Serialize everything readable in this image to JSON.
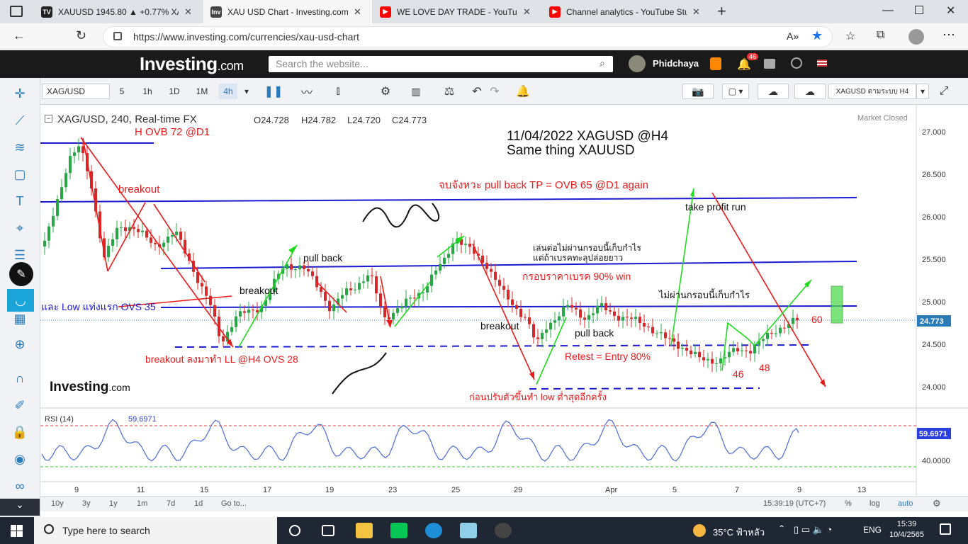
{
  "browser": {
    "tabs": [
      {
        "title": "XAUUSD 1945.80 ▲ +0.77% XAU",
        "icon": "tradingview-icon",
        "color": "#222222"
      },
      {
        "title": "XAU USD Chart - Investing.com",
        "icon": "investing-icon",
        "color": "#333333"
      },
      {
        "title": "WE LOVE DAY TRADE - YouTube",
        "icon": "youtube-icon",
        "color": "#ff0000"
      },
      {
        "title": "Channel analytics - YouTube Stud",
        "icon": "youtube-icon",
        "color": "#ff0000"
      }
    ],
    "url": "https://www.investing.com/currencies/xau-usd-chart"
  },
  "site": {
    "logo": "Investing",
    "logo_suffix": ".com",
    "search_placeholder": "Search the website...",
    "user": "Phidchaya",
    "notif_count": "46"
  },
  "toolbar": {
    "symbol": "XAG/USD",
    "intervals": [
      "5",
      "1h",
      "1D",
      "1M",
      "4h"
    ],
    "active_interval": "4h",
    "template": "XAGUSD ตามระบบ H4"
  },
  "chart": {
    "title": "XAG/USD, 240, Real-time FX",
    "ohlc": {
      "o": "O24.728",
      "h": "H24.782",
      "l": "L24.720",
      "c": "C24.773"
    },
    "market_status": "Market Closed",
    "price_ticks": [
      "27.000",
      "26.500",
      "26.000",
      "25.500",
      "25.000",
      "24.500",
      "24.000"
    ],
    "current_price": "24.773",
    "x_ticks": [
      "9",
      "11",
      "15",
      "17",
      "19",
      "23",
      "25",
      "29",
      "Apr",
      "5",
      "7",
      "9",
      "13"
    ],
    "watermark": "Investing",
    "watermark_suffix": ".com",
    "annotations": {
      "date_title": "11/04/2022 XAGUSD @H4",
      "subtitle": "Same thing XAUUSD",
      "hovb": "H OVB 72 @D1",
      "breakout1": "breakout",
      "tp_line": "จบจังหวะ pull back TP = OVB 65 @D1 again",
      "take_profit": "take profit run",
      "thai_note1": "เล่นต่อไม่ผ่านกรอบนี้เก็บกำไร",
      "thai_note2": "แต่ถ้าเบรคทะลุปล่อยยาว",
      "pullback1": "pull back",
      "breakout2": "breakout",
      "frame_break": "กรอบราคาเบรค 90% win",
      "no_pass": "ไม่ผ่านกรอบนี้เก็บกำไร",
      "low_ovs": "และ Low แท่งแรก OVS 35",
      "breakout3": "breakout",
      "pullback2": "pull back",
      "retest": "Retest = Entry 80%",
      "breakout_ll": "breakout ลงมาทำ LL @H4 OVS 28",
      "before_low": "ก่อนปรับตัวขึ้นทำ low ต่ำสุดอีกครั้ง",
      "n60": "60",
      "n46": "46",
      "n48": "48"
    }
  },
  "rsi": {
    "label": "RSI (14)",
    "value": "59.6971",
    "ticks": [
      "40.0000"
    ]
  },
  "footer": {
    "ranges": [
      "10y",
      "3y",
      "1y",
      "1m",
      "7d",
      "1d",
      "Go to..."
    ],
    "time": "15:39:19 (UTC+7)",
    "opts": [
      "%",
      "log",
      "auto"
    ]
  },
  "taskbar": {
    "search": "Type here to search",
    "weather": "35°C ฟ้าหลัว",
    "lang": "ENG",
    "time": "15:39",
    "date": "10/4/2565"
  }
}
